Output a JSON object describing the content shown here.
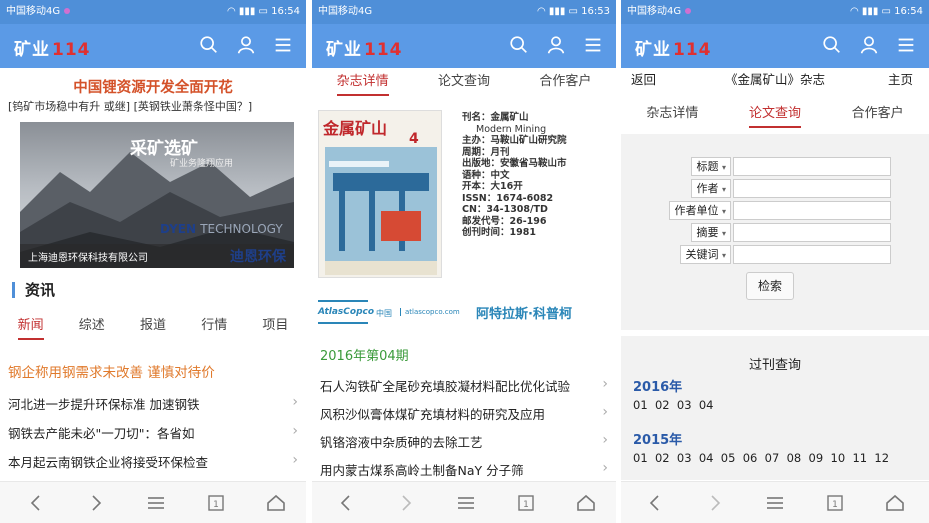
{
  "status_bar": {
    "carrier": "中国移动4G",
    "time1": "16:54",
    "time2": "16:53",
    "time3": "16:54"
  },
  "app": {
    "logo_text": "矿业",
    "logo_number": "114"
  },
  "screen1": {
    "promo_title": "中国锂资源开发全面开花",
    "promo_sub": "[钨矿市场稳中有升 或继] [英钢铁业萧条怪中国？]",
    "banner_big": "采矿选矿",
    "banner_sub": "矿业务隆翔应用",
    "banner_brand": "DYEN",
    "banner_brand2": "TECHNOLOGY",
    "banner_company": "上海迪恩环保科技有限公司",
    "banner_company2": "迪恩环保",
    "section_title": "资讯",
    "tabs": [
      "新闻",
      "综述",
      "报道",
      "行情",
      "项目"
    ],
    "headline": "钢企称用钢需求未改善 谨慎对待价",
    "news": [
      "河北进一步提升环保标准 加速钢铁",
      "钢铁去产能未必\"一刀切\"：各省如",
      "本月起云南钢铁企业将接受环保检查"
    ]
  },
  "screen2": {
    "tabs": [
      "杂志详情",
      "论文查询",
      "合作客户"
    ],
    "cover_title": "金属矿山",
    "cover_issue": "4",
    "info": [
      "刊名：金属矿山",
      "Modern Mining",
      "主办：马鞍山矿山研究院",
      "周期：月刊",
      "出版地：安徽省马鞍山市",
      "语种：中文",
      "开本：大16开",
      "ISSN：1674-6082",
      "CN：34-1308/TD",
      "邮发代号：26-196",
      "创刊时间：1981"
    ],
    "ad_brand": "AtlasCopco",
    "ad_china": "中国",
    "ad_url": "atlascopco.com",
    "ad_name": "阿特拉斯·科普柯",
    "issue_label": "2016年第04期",
    "articles": [
      "石人沟铁矿全尾砂充填胶凝材料配比优化试验",
      "风积沙似膏体煤矿充填材料的研究及应用",
      "钒铬溶液中杂质砷的去除工艺",
      "用内蒙古煤系高岭土制备NaY 分子筛"
    ]
  },
  "screen3": {
    "back": "返回",
    "title": "《金属矿山》杂志",
    "home": "主页",
    "tabs": [
      "杂志详情",
      "论文查询",
      "合作客户"
    ],
    "fields": [
      "标题",
      "作者",
      "作者单位",
      "摘要",
      "关键词"
    ],
    "search_button": "检索",
    "past_title": "过刊查询",
    "year1": "2016年",
    "year1_issues": "01  02  03  04",
    "year2": "2015年",
    "year2_issues": "01  02  03  04  05  06  07  08  09  10  11  12"
  }
}
